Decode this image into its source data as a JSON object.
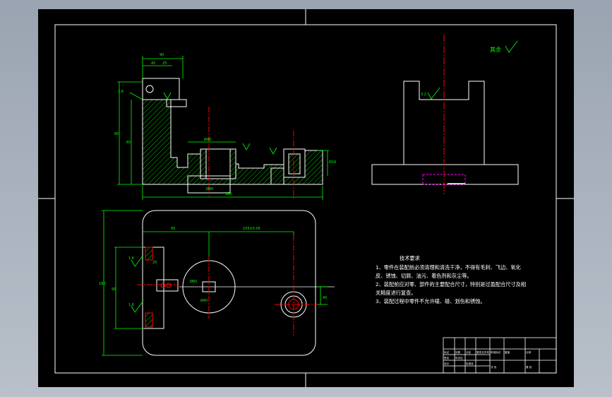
{
  "colors": {
    "background": "#a6afbb",
    "sheet": "#000000",
    "outline": "#ffffff",
    "dimension": "#00ff00",
    "centerline": "#ff0000",
    "hatch": "#00ff00",
    "hidden": "#ff00ff",
    "annotation": "#00ff00"
  },
  "roughness": {
    "label": "其余"
  },
  "tech_requirements": {
    "title": "技术要求",
    "lines": [
      "1、零件在装配前必须清理和清洗干净，不得有毛刺、飞边、氧化",
      "皮、锈蚀、切屑、油污、着色剂和灰尘等。",
      "2、装配前应对零、部件的主要配合尺寸，特别是过盈配合尺寸及相",
      "关精度进行复查。",
      "3、装配过程中零件不允许磕、碰、划伤和锈蚀。"
    ]
  },
  "title_block": {
    "cells": [
      "标记",
      "处数",
      "分区",
      "更改文件号",
      "签名",
      "年月日",
      "设计",
      "标准化",
      "阶段标记",
      "重量",
      "比例",
      "共 张",
      "第 张"
    ]
  }
}
